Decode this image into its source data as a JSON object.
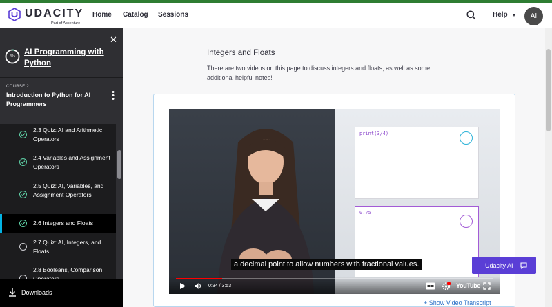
{
  "brand": {
    "name": "UDACITY",
    "tagline": "Part of Accenture"
  },
  "nav": {
    "links": [
      "Home",
      "Catalog",
      "Sessions"
    ],
    "help_label": "Help",
    "avatar_initials": "AI"
  },
  "sidebar": {
    "progress_text": "4%",
    "progress_fraction": 0.04,
    "program_title": "AI Programming with Python",
    "course_label": "COURSE 2",
    "course_title": "Introduction to Python for AI Programmers",
    "lessons": [
      {
        "label": "2.3  Quiz: AI and Arithmetic Operators",
        "status": "complete"
      },
      {
        "label": "2.4  Variables and Assignment Operators",
        "status": "complete"
      },
      {
        "label": "2.5  Quiz: AI, Variables, and Assignment Operators",
        "status": "complete"
      },
      {
        "label": "2.6  Integers and Floats",
        "status": "complete",
        "active": true
      },
      {
        "label": "2.7  Quiz: AI, Integers, and Floats",
        "status": "incomplete"
      },
      {
        "label": "2.8  Booleans, Comparison Operators",
        "status": "incomplete"
      }
    ],
    "downloads_label": "Downloads"
  },
  "page": {
    "title": "Integers and Floats",
    "description": "There are two videos on this page to discuss integers and floats, as well as some additional helpful notes!"
  },
  "video": {
    "code_top": "print(3/4)",
    "code_output": "0.75",
    "subtitle": "a decimal point to allow numbers with fractional values.",
    "time": "0:34 / 3:53",
    "progress_fraction": 0.146,
    "youtube_label": "YouTube",
    "transcript_link": "+ Show Video Transcript"
  },
  "assistant": {
    "label": "Udacity AI"
  },
  "colors": {
    "accent_purple": "#5a3ed6",
    "check_green": "#5fd3a8",
    "active_border": "#02b3e4",
    "header_green": "#2e7d32"
  }
}
